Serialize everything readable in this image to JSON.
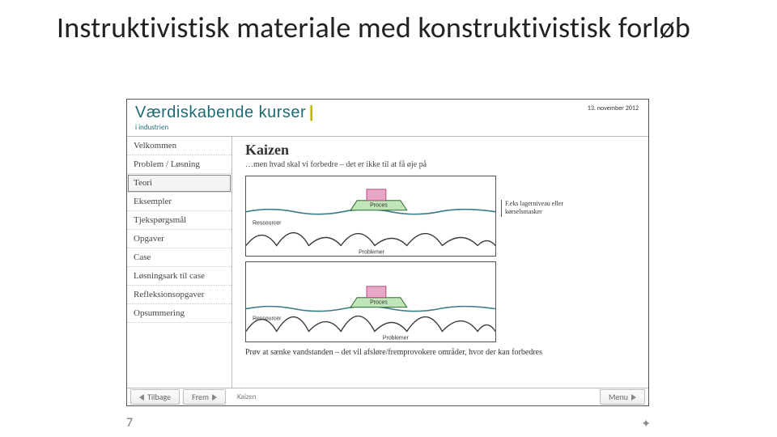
{
  "slide": {
    "title": "Instruktivistisk materiale med konstruktivistisk forløb",
    "page_number": "7",
    "star": "✦"
  },
  "embedded": {
    "logo_main": "Værdiskabende kurser",
    "logo_bar": "|",
    "logo_sub": "i industrien",
    "date": "13. november 2012",
    "sidebar": {
      "items": [
        {
          "label": "Velkommen"
        },
        {
          "label": "Problem / Løsning"
        },
        {
          "label": "Teori"
        },
        {
          "label": "Eksempler"
        },
        {
          "label": "Tjekspørgsmål"
        },
        {
          "label": "Opgaver"
        },
        {
          "label": "Case"
        },
        {
          "label": "Løsningsark til case"
        },
        {
          "label": "Refleksionsopgaver"
        },
        {
          "label": "Opsummering"
        }
      ],
      "active_index": 2
    },
    "content": {
      "title": "Kaizen",
      "lead": "…men hvad skal vi forbedre – det er ikke til at få øje på",
      "diagram": {
        "ship_label": "Proces",
        "upper_wave_label": "Ressourcer",
        "lower_wave_label": "Problemer"
      },
      "side_note": "F.eks lagerniveau eller kørselsmasker",
      "bottom_text": "Prøv at sænke vandstanden – det vil afsløre/fremprovokere områder, hvor der kan forbedres"
    },
    "footer": {
      "back": "Tilbage",
      "forward": "Frem",
      "middle": "Kaizen",
      "menu": "Menu"
    }
  }
}
